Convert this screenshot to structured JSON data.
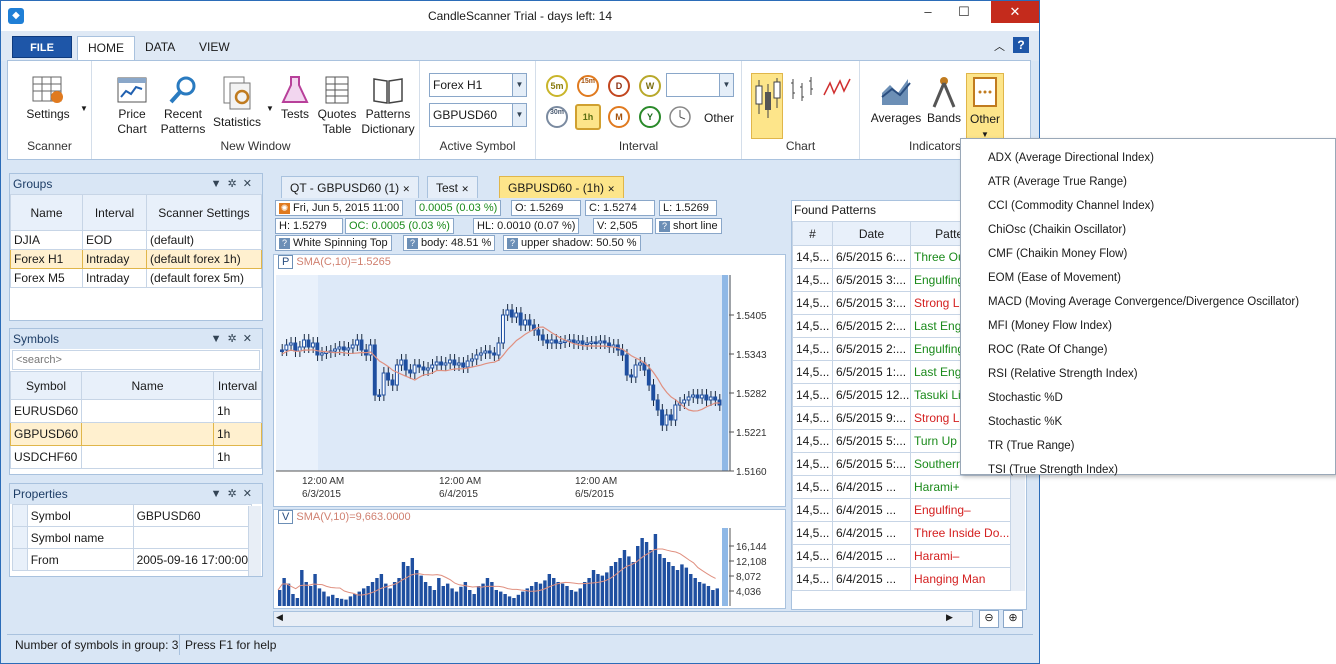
{
  "window": {
    "title": "CandleScanner Trial  - days left: 14"
  },
  "menu": {
    "file": "FILE",
    "tabs": [
      "HOME",
      "DATA",
      "VIEW"
    ]
  },
  "ribbon": {
    "scanner": {
      "settings": "Settings",
      "caption": "Scanner"
    },
    "new_window": {
      "price_chart": "Price Chart",
      "recent_patterns": "Recent Patterns",
      "statistics": "Statistics",
      "tests": "Tests",
      "quotes_table": "Quotes Table",
      "patterns_dictionary": "Patterns Dictionary",
      "caption": "New Window"
    },
    "active_symbol": {
      "group": "Forex H1",
      "symbol": "GBPUSD60",
      "caption": "Active Symbol"
    },
    "interval": {
      "buttons": [
        "5m",
        "15m",
        "D",
        "W",
        "30m",
        "1h",
        "M",
        "Y"
      ],
      "other": "Other",
      "caption": "Interval"
    },
    "chart": {
      "caption": "Chart"
    },
    "indicators": {
      "averages": "Averages",
      "bands": "Bands",
      "other": "Other",
      "caption": "Indicators"
    }
  },
  "groups": {
    "title": "Groups",
    "columns": [
      "Name",
      "Interval",
      "Scanner Settings"
    ],
    "rows": [
      [
        "DJIA",
        "EOD",
        "(default)"
      ],
      [
        "Forex H1",
        "Intraday",
        "(default forex 1h)"
      ],
      [
        "Forex M5",
        "Intraday",
        "(default forex 5m)"
      ]
    ]
  },
  "symbols": {
    "title": "Symbols",
    "search_placeholder": "<search>",
    "columns": [
      "Symbol",
      "Name",
      "Interval"
    ],
    "rows": [
      [
        "EURUSD60",
        "",
        "1h"
      ],
      [
        "GBPUSD60",
        "",
        "1h"
      ],
      [
        "USDCHF60",
        "",
        "1h"
      ]
    ]
  },
  "properties": {
    "title": "Properties",
    "rows": [
      [
        "Symbol",
        "GBPUSD60"
      ],
      [
        "Symbol name",
        ""
      ],
      [
        "From",
        "2005-09-16 17:00:00"
      ]
    ]
  },
  "doc_tabs": [
    "QT - GBPUSD60 (1)",
    "Test",
    "GBPUSD60 - (1h)"
  ],
  "info": {
    "date": "Fri, Jun 5, 2015  11:00",
    "chg": "0.0005   (0.03 %)",
    "o": "O:     1.5269",
    "c": "C:     1.5274",
    "l": "L:     1.5269",
    "h": "H:     1.5279",
    "oc": "OC:    0.0005   (0.03 %)",
    "hl": "HL:    0.0010   (0.07 %)",
    "v": "V:     2,505",
    "pattern1": "short line",
    "pattern2": "White Spinning Top",
    "body": "body:   48.51 %",
    "shadow": "upper shadow:   50.50 %"
  },
  "chart": {
    "price_label": "SMA(C,10)=1.5265",
    "vol_label": "SMA(V,10)=9,663.0000",
    "p_tag": "P",
    "v_tag": "V",
    "price_ticks": [
      "1.5405",
      "1.5343",
      "1.5282",
      "1.5221",
      "1.5160"
    ],
    "vol_ticks": [
      "16,144",
      "12,108",
      "8,072",
      "4,036"
    ],
    "x_ticks": [
      [
        "12:00 AM",
        "6/3/2015"
      ],
      [
        "12:00 AM",
        "6/4/2015"
      ],
      [
        "12:00 AM",
        "6/5/2015"
      ]
    ]
  },
  "found_patterns": {
    "title": "Found Patterns",
    "columns": [
      "#",
      "Date",
      "Pattern N"
    ],
    "rows": [
      [
        "14,5...",
        "6/5/2015  6:...",
        "Three Ou",
        "green"
      ],
      [
        "14,5...",
        "6/5/2015  3:...",
        "Engulfing",
        "green"
      ],
      [
        "14,5...",
        "6/5/2015  3:...",
        "Strong Li",
        "red"
      ],
      [
        "14,5...",
        "6/5/2015  2:...",
        "Last Engu",
        "green"
      ],
      [
        "14,5...",
        "6/5/2015  2:...",
        "Engulfing",
        "green"
      ],
      [
        "14,5...",
        "6/5/2015  1:...",
        "Last Eng",
        "green"
      ],
      [
        "14,5...",
        "6/5/2015  12...",
        "Tasuki Li",
        "green"
      ],
      [
        "14,5...",
        "6/5/2015  9:...",
        "Strong Li",
        "red"
      ],
      [
        "14,5...",
        "6/5/2015  5:...",
        "Turn Up",
        "green"
      ],
      [
        "14,5...",
        "6/5/2015  5:...",
        "Southern",
        "green"
      ],
      [
        "14,5...",
        "6/4/2015  ...",
        "Harami+",
        "green"
      ],
      [
        "14,5...",
        "6/4/2015  ...",
        "Engulfing–",
        "red"
      ],
      [
        "14,5...",
        "6/4/2015  ...",
        "Three Inside Do...",
        "red"
      ],
      [
        "14,5...",
        "6/4/2015  ...",
        "Harami–",
        "red"
      ],
      [
        "14,5...",
        "6/4/2015  ...",
        "Hanging Man",
        "red"
      ]
    ]
  },
  "indicators_menu": [
    "ADX  (Average Directional Index)",
    "ATR  (Average True Range)",
    "CCI  (Commodity Channel Index)",
    "ChiOsc  (Chaikin Oscillator)",
    "CMF  (Chaikin Money Flow)",
    "EOM  (Ease of Movement)",
    "MACD  (Moving Average Convergence/Divergence Oscillator)",
    "MFI  (Money Flow Index)",
    "ROC  (Rate Of Change)",
    "RSI  (Relative Strength Index)",
    "Stochastic %D",
    "Stochastic %K",
    "TR  (True Range)",
    "TSI  (True Strength Index)"
  ],
  "status": {
    "left": "Number of symbols in group: 3",
    "right": "Press F1 for help"
  },
  "colors": {
    "accent": "#1e56a8",
    "selection": "#fde58a",
    "bull": "#1a8a1a",
    "bear": "#d42020"
  }
}
